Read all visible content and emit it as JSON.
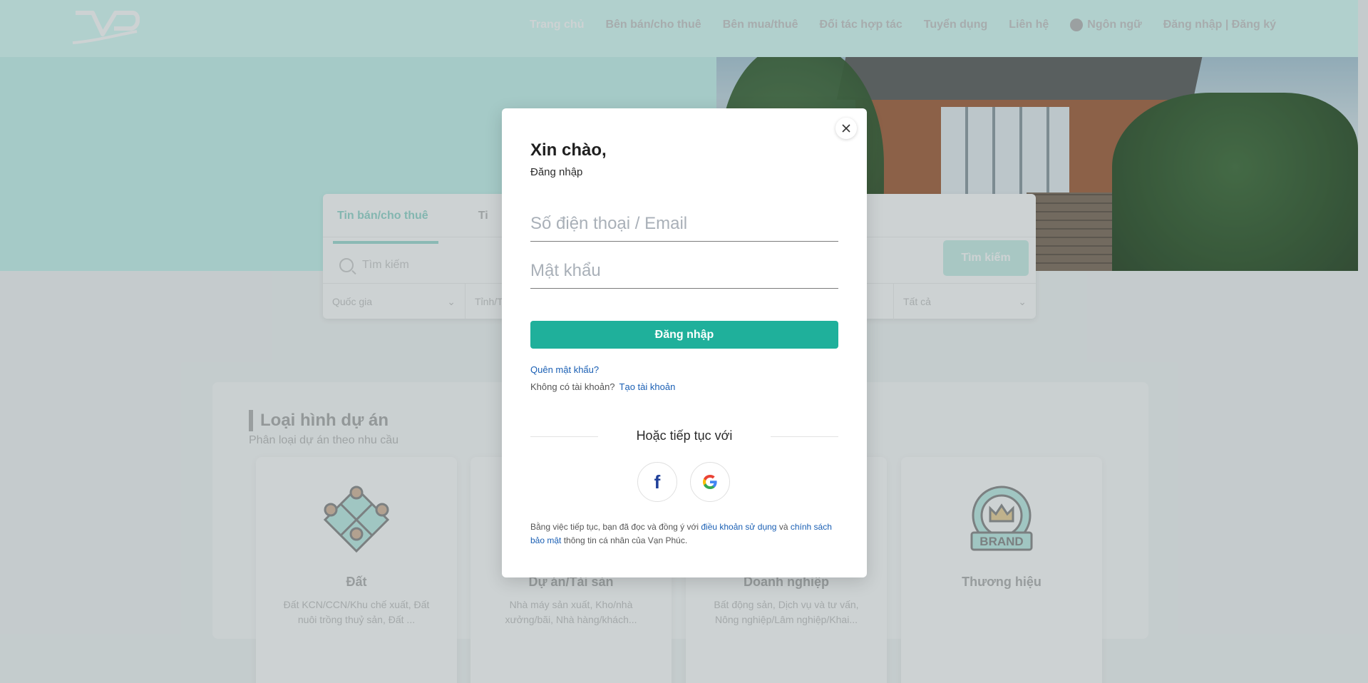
{
  "nav": {
    "items": [
      "Trang chủ",
      "Bên bán/cho thuê",
      "Bên mua/thuê",
      "Đối tác hợp tác",
      "Tuyển dụng",
      "Liên hệ"
    ],
    "language": "Ngôn ngữ",
    "auth": "Đăng nhập | Đăng ký"
  },
  "search": {
    "tabs": [
      "Tin bán/cho thuê",
      "Ti"
    ],
    "placeholder": "Tìm kiếm",
    "button": "Tìm kiếm",
    "filters": [
      "Quốc gia",
      "Tỉnh/T",
      "Tất cả"
    ]
  },
  "section": {
    "title": "Loại hình dự án",
    "subtitle": "Phân loại dự án theo nhu cầu",
    "cards": [
      {
        "title": "Đất",
        "desc": "Đất KCN/CCN/Khu chế xuất, Đất nuôi trồng thuỷ sản, Đất ...",
        "icon": "map-pin-icon"
      },
      {
        "title": "Dự án/Tài sản",
        "desc": "Nhà máy sản xuất, Kho/nhà xưởng/bãi, Nhà hàng/khách...",
        "icon": "building-icon"
      },
      {
        "title": "Doanh nghiệp",
        "desc": "Bất động sản, Dịch vụ và tư vấn, Nông nghiệp/Lâm nghiệp/Khai...",
        "icon": "briefcase-icon"
      },
      {
        "title": "Thương hiệu",
        "desc": "",
        "icon": "brand-badge-icon"
      }
    ],
    "brand_badge_text": "BRAND"
  },
  "modal": {
    "title": "Xin chào,",
    "subtitle": "Đăng nhập",
    "phone_placeholder": "Số điện thoại / Email",
    "password_placeholder": "Mật khẩu",
    "submit": "Đăng nhập",
    "forgot": "Quên mật khẩu?",
    "no_account": "Không có tài khoản?",
    "create_account": "Tạo tài khoản",
    "or_continue": "Hoặc tiếp tục với",
    "terms_prefix": "Bằng việc tiếp tục, bạn đã đọc và đồng ý với",
    "terms_link": "điều khoản sử dụng",
    "terms_and": "và",
    "privacy_link": "chính sách bảo mật",
    "terms_suffix": "thông tin cá nhân của Vạn Phúc."
  },
  "colors": {
    "accent": "#1fb09b",
    "link": "#1a5fb4",
    "hero": "#c6f4ee"
  }
}
